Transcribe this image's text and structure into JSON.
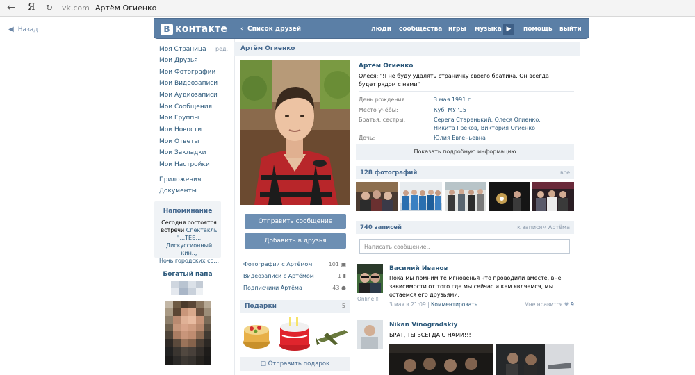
{
  "browser": {
    "back_icon": "arrow-left",
    "ya_label": "Я",
    "domain": "vk.com",
    "title": "Артём Огиенко"
  },
  "back_link": "Назад",
  "header": {
    "logo_letter": "В",
    "logo_text": "контакте",
    "friends_link": "Список друзей",
    "menu": [
      "люди",
      "сообщества",
      "игры",
      "музыка",
      "помощь",
      "выйти"
    ]
  },
  "left_menu": {
    "edit": "ред.",
    "items": [
      "Моя Страница",
      "Мои Друзья",
      "Мои Фотографии",
      "Мои Видеозаписи",
      "Мои Аудиозаписи",
      "Мои Сообщения",
      "Мои Группы",
      "Мои Новости",
      "Мои Ответы",
      "Мои Закладки",
      "Мои Настройки"
    ],
    "extra_items": [
      "Приложения",
      "Документы"
    ]
  },
  "reminder": {
    "title": "Напоминание",
    "line1": "Сегодня состоятся",
    "line2_prefix": "встречи ",
    "line2_link": "Спектакль",
    "line3": "\"...ТЕБ..,",
    "line4": "Дискуссионный кин..,",
    "line5": "Ночь городских со..."
  },
  "ad": {
    "title": "Богатый папа"
  },
  "page_title": "Артём Огиенко",
  "buttons": {
    "message": "Отправить сообщение",
    "add_friend": "Добавить в друзья"
  },
  "counters": [
    {
      "label": "Фотографии с Артёмом",
      "value": "101"
    },
    {
      "label": "Видеозаписи с Артёмом",
      "value": "1"
    },
    {
      "label": "Подписчики Артёма",
      "value": "43"
    }
  ],
  "gifts": {
    "title": "Подарки",
    "count": "5",
    "send": "Отправить подарок"
  },
  "profile": {
    "name": "Артём Огиенко",
    "status": "Олеся: \"Я не буду удалять страничку своего братика. Он всегда будет рядом с нами\"",
    "birthday_label": "День рождения:",
    "birthday": "3 мая 1991 г.",
    "study_label": "Место учёбы:",
    "study": "КубГМУ '15",
    "siblings_label": "Братья, сестры:",
    "siblings": "Серега Старенький, Олеся Огиенко, Никита Греков, Виктория Огиенко",
    "daughter_label": "Дочь:",
    "daughter": "Юлия Евгеньевна",
    "details": "Показать подробную информацию"
  },
  "photos": {
    "title": "128 фотографий",
    "all": "все"
  },
  "wall": {
    "title": "740 записей",
    "link": "к записям Артёма",
    "input_placeholder": "Написать сообщение..",
    "posts": [
      {
        "author": "Василий Иванов",
        "text": "Пока мы помним те мгновенья что проводили вместе, вне зависимости от того где мы сейчас и кем являемся, мы остаемся его друзьями.",
        "online": "Online",
        "date": "3 мая в 21:09",
        "comment": "Комментировать",
        "like_label": "Мне нравится",
        "likes": "9"
      },
      {
        "author": "Nikan Vinogradskiy",
        "text": "БРАТ, ТЫ ВСЕГДА С НАМИ!!!"
      }
    ]
  },
  "colors": {
    "header": "#5b7fa6",
    "link": "#2b587a",
    "button": "#6d8fb3",
    "panel": "#edf1f5"
  }
}
